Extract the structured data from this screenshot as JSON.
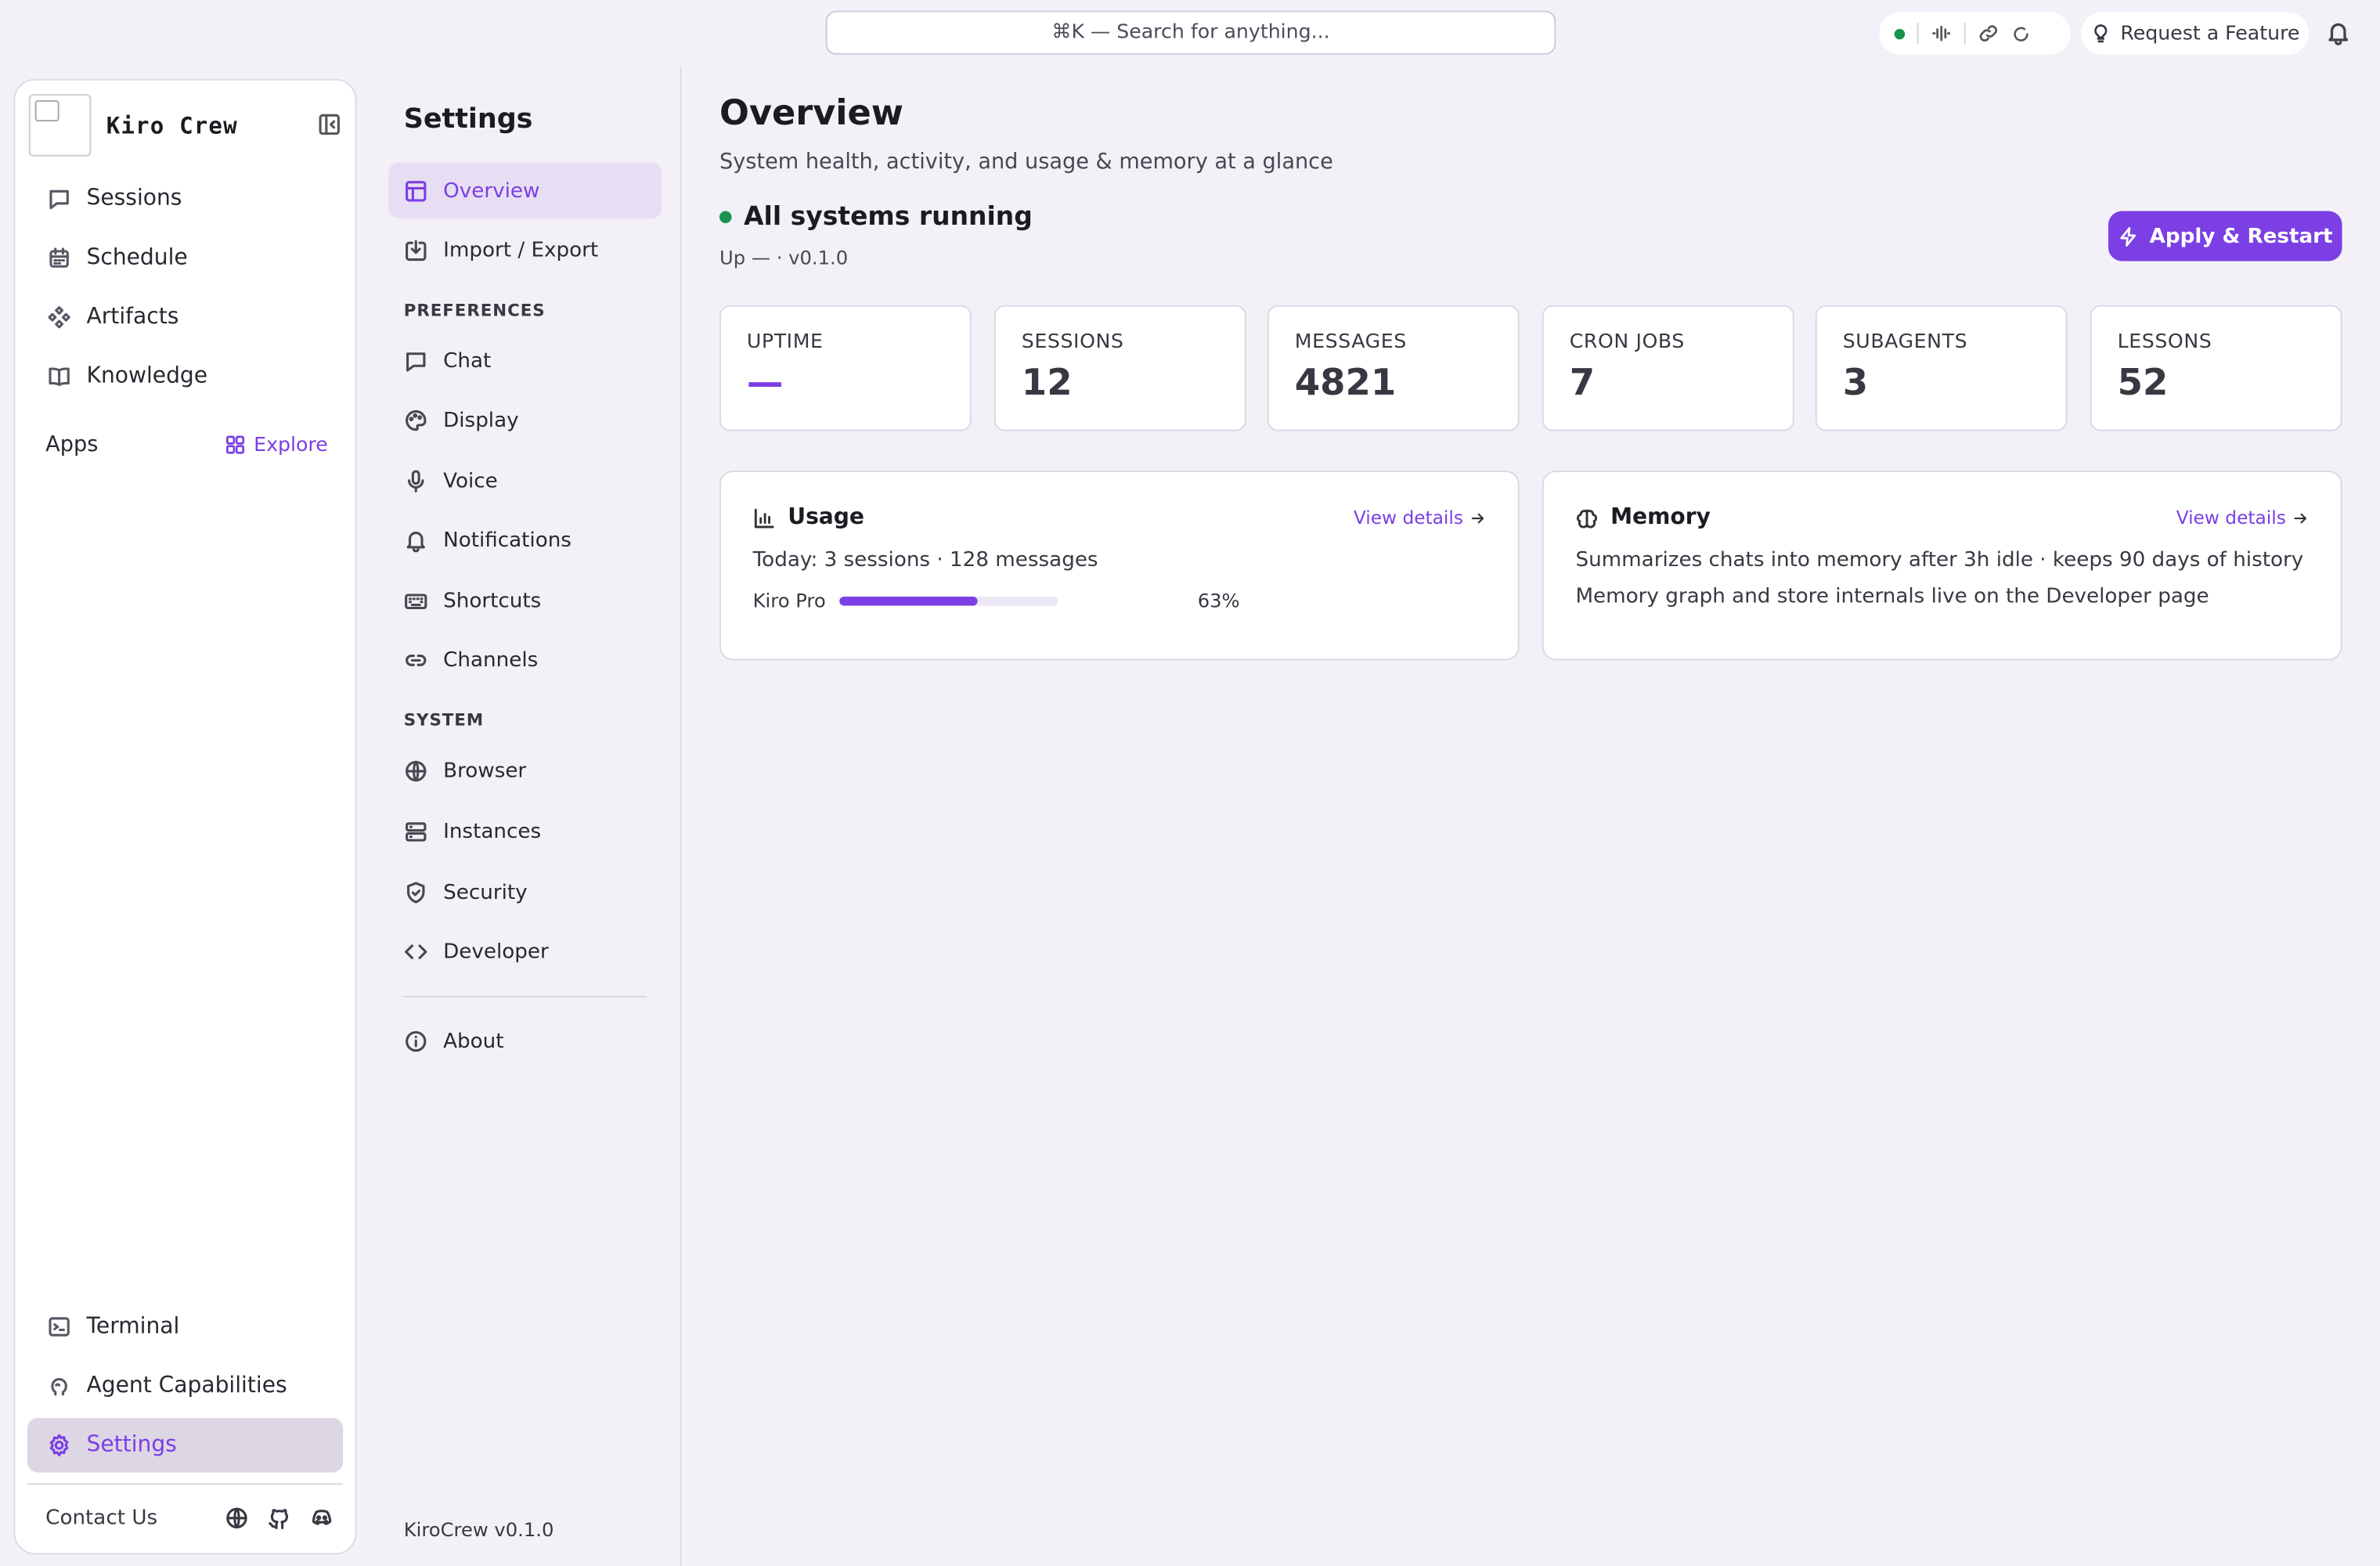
{
  "topbar": {
    "search_placeholder": "⌘K — Search for anything...",
    "request_feature": "Request a Feature",
    "connection_color": "#179450"
  },
  "sidebar": {
    "brand": "Kiro Crew",
    "nav": [
      {
        "label": "Sessions",
        "icon": "chat-icon"
      },
      {
        "label": "Schedule",
        "icon": "calendar-icon"
      },
      {
        "label": "Artifacts",
        "icon": "artifacts-icon"
      },
      {
        "label": "Knowledge",
        "icon": "book-icon"
      }
    ],
    "apps_label": "Apps",
    "explore_label": "Explore",
    "bottom": [
      {
        "label": "Terminal",
        "icon": "terminal-icon"
      },
      {
        "label": "Agent Capabilities",
        "icon": "brain-icon"
      },
      {
        "label": "Settings",
        "icon": "gear-icon",
        "active": true
      }
    ],
    "contact_label": "Contact Us"
  },
  "settings_nav": {
    "title": "Settings",
    "top": [
      {
        "label": "Overview",
        "icon": "layout-icon",
        "active": true
      },
      {
        "label": "Import / Export",
        "icon": "download-icon"
      }
    ],
    "preferences_heading": "PREFERENCES",
    "preferences": [
      {
        "label": "Chat",
        "icon": "chat-icon"
      },
      {
        "label": "Display",
        "icon": "palette-icon"
      },
      {
        "label": "Voice",
        "icon": "mic-icon"
      },
      {
        "label": "Notifications",
        "icon": "bell-icon"
      },
      {
        "label": "Shortcuts",
        "icon": "keyboard-icon"
      },
      {
        "label": "Channels",
        "icon": "link-icon"
      }
    ],
    "system_heading": "SYSTEM",
    "system": [
      {
        "label": "Browser",
        "icon": "globe-icon"
      },
      {
        "label": "Instances",
        "icon": "server-icon"
      },
      {
        "label": "Security",
        "icon": "shield-icon"
      },
      {
        "label": "Developer",
        "icon": "code-icon"
      }
    ],
    "about": "About",
    "version": "KiroCrew v0.1.0"
  },
  "overview": {
    "title": "Overview",
    "subtitle": "System health, activity, and usage & memory at a glance",
    "status": "All systems running",
    "meta": "Up — · v0.1.0",
    "apply_label": "Apply & Restart",
    "accent_color": "#7b3fe4",
    "stats": [
      {
        "label": "UPTIME",
        "value": "—"
      },
      {
        "label": "SESSIONS",
        "value": "12"
      },
      {
        "label": "MESSAGES",
        "value": "4821"
      },
      {
        "label": "CRON JOBS",
        "value": "7"
      },
      {
        "label": "SUBAGENTS",
        "value": "3"
      },
      {
        "label": "LESSONS",
        "value": "52"
      }
    ],
    "usage": {
      "title": "Usage",
      "view": "View details",
      "today": "Today: 3 sessions · 128 messages",
      "plan": "Kiro Pro",
      "percent_label": "63%",
      "fill_fraction": 0.63
    },
    "memory": {
      "title": "Memory",
      "view": "View details",
      "line1": "Summarizes chats into memory after 3h idle · keeps 90 days of history",
      "line2": "Memory graph and store internals live on the Developer page"
    }
  }
}
